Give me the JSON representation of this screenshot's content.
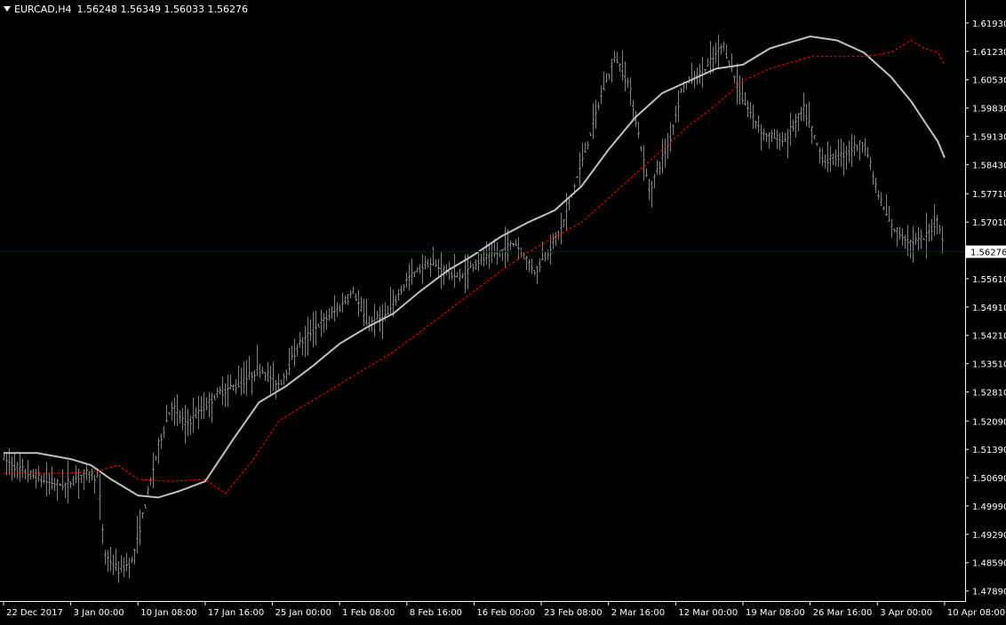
{
  "header": {
    "symbol": "EURCAD,H4",
    "open": "1.56248",
    "high": "1.56349",
    "low": "1.56033",
    "close": "1.56276"
  },
  "colors": {
    "background": "#000000",
    "axis": "#ffffff",
    "bars": "#808080",
    "ma_solid": "#c0c0c0",
    "ma_dashed": "#ff0000",
    "price_line": "#00008b",
    "price_label_bg": "#ffffff",
    "price_label_text": "#000000"
  },
  "chart_data": {
    "type": "line",
    "instrument": "EURCAD",
    "timeframe": "H4",
    "title": "EURCAD,H4",
    "current_price": 1.56276,
    "ylim": [
      1.4775,
      1.6228
    ],
    "y_ticks": [
      "1.61930",
      "1.61230",
      "1.60530",
      "1.59830",
      "1.59130",
      "1.58430",
      "1.57710",
      "1.57010",
      "1.56310",
      "1.55610",
      "1.54910",
      "1.54210",
      "1.53510",
      "1.52810",
      "1.52090",
      "1.51390",
      "1.50690",
      "1.49990",
      "1.49290",
      "1.48590",
      "1.47890"
    ],
    "x_ticks": [
      "22 Dec 2017",
      "3 Jan 00:00",
      "10 Jan 08:00",
      "17 Jan 16:00",
      "25 Jan 00:00",
      "1 Feb 08:00",
      "8 Feb 16:00",
      "16 Feb 00:00",
      "23 Feb 08:00",
      "2 Mar 16:00",
      "12 Mar 00:00",
      "19 Mar 08:00",
      "26 Mar 16:00",
      "3 Apr 00:00",
      "10 Apr 08:00"
    ],
    "x_range": [
      0,
      14.2
    ],
    "grid": false,
    "price_series": {
      "x": [
        0,
        0.3,
        0.6,
        0.9,
        1.2,
        1.4,
        1.5,
        1.7,
        1.9,
        2.1,
        2.3,
        2.5,
        2.7,
        2.9,
        3.2,
        3.5,
        3.8,
        4.1,
        4.4,
        4.7,
        5.0,
        5.2,
        5.4,
        5.7,
        6.0,
        6.3,
        6.6,
        6.8,
        7.0,
        7.3,
        7.6,
        7.9,
        8.1,
        8.3,
        8.6,
        8.9,
        9.1,
        9.3,
        9.6,
        9.9,
        10.1,
        10.4,
        10.7,
        11.0,
        11.3,
        11.6,
        11.9,
        12.2,
        12.5,
        12.8,
        13.0,
        13.2,
        13.5,
        13.7,
        13.9,
        14.0
      ],
      "y": [
        1.5115,
        1.5085,
        1.506,
        1.505,
        1.508,
        1.507,
        1.488,
        1.484,
        1.486,
        1.5,
        1.515,
        1.525,
        1.52,
        1.523,
        1.528,
        1.53,
        1.534,
        1.53,
        1.54,
        1.545,
        1.549,
        1.553,
        1.545,
        1.547,
        1.556,
        1.56,
        1.558,
        1.556,
        1.56,
        1.562,
        1.565,
        1.558,
        1.563,
        1.569,
        1.585,
        1.602,
        1.611,
        1.604,
        1.578,
        1.59,
        1.604,
        1.607,
        1.614,
        1.6,
        1.592,
        1.59,
        1.598,
        1.585,
        1.587,
        1.59,
        1.577,
        1.569,
        1.565,
        1.566,
        1.571,
        1.5628
      ]
    },
    "series": [
      {
        "x": [
          0,
          0.5,
          1.0,
          1.3,
          1.6,
          2.0,
          2.3,
          2.6,
          3.0,
          3.4,
          3.8,
          4.2,
          4.6,
          5.0,
          5.4,
          5.8,
          6.2,
          6.6,
          7.0,
          7.4,
          7.8,
          8.2,
          8.6,
          9.0,
          9.4,
          9.8,
          10.2,
          10.6,
          11.0,
          11.4,
          11.8,
          12.0,
          12.4,
          12.8,
          13.2,
          13.5,
          13.7,
          13.9,
          14.0
        ],
        "y": [
          1.513,
          1.513,
          1.5115,
          1.51,
          1.5065,
          1.5025,
          1.502,
          1.5035,
          1.506,
          1.516,
          1.5255,
          1.5295,
          1.5345,
          1.54,
          1.544,
          1.5475,
          1.553,
          1.558,
          1.562,
          1.5665,
          1.57,
          1.573,
          1.579,
          1.588,
          1.596,
          1.602,
          1.605,
          1.608,
          1.609,
          1.613,
          1.615,
          1.616,
          1.615,
          1.612,
          1.606,
          1.6,
          1.595,
          1.59,
          1.586
        ]
      },
      {
        "x": [
          0,
          0.5,
          1.0,
          1.4,
          1.7,
          2.0,
          2.5,
          3.0,
          3.3,
          3.7,
          4.1,
          4.5,
          5.0,
          5.4,
          5.8,
          6.2,
          6.6,
          7.0,
          7.4,
          7.8,
          8.2,
          8.6,
          9.0,
          9.4,
          9.8,
          10.2,
          10.6,
          11.0,
          11.4,
          11.8,
          12.0,
          12.4,
          12.8,
          13.2,
          13.5,
          13.7,
          13.9,
          14.0
        ],
        "y": [
          1.508,
          1.508,
          1.508,
          1.5085,
          1.51,
          1.5065,
          1.506,
          1.5065,
          1.503,
          1.511,
          1.521,
          1.525,
          1.53,
          1.534,
          1.538,
          1.543,
          1.548,
          1.553,
          1.558,
          1.5625,
          1.5665,
          1.57,
          1.576,
          1.582,
          1.588,
          1.594,
          1.599,
          1.605,
          1.608,
          1.61,
          1.611,
          1.611,
          1.611,
          1.612,
          1.615,
          1.613,
          1.612,
          1.609
        ]
      }
    ]
  }
}
